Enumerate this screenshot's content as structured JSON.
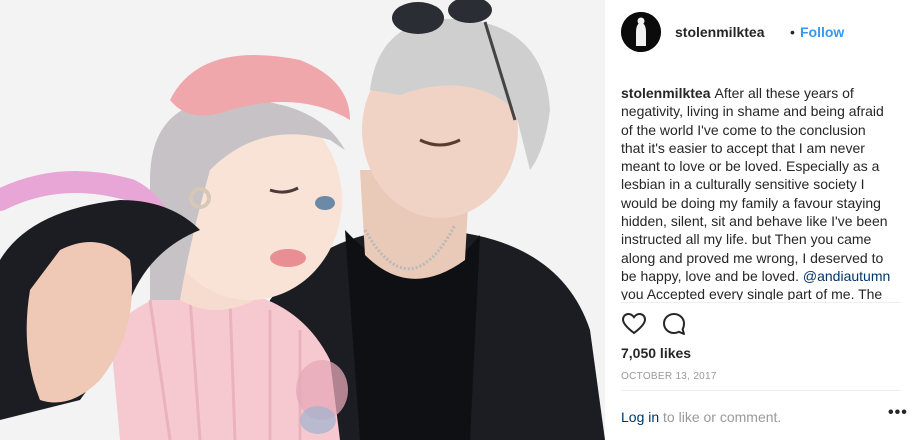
{
  "post": {
    "image_alt": "",
    "header": {
      "username": "stolenmilktea",
      "separator": "•",
      "follow_label": "Follow"
    },
    "caption": {
      "username": "stolenmilktea",
      "text_before_mention": "After all these years of negativity, living in shame and being afraid of the world I've come to the conclusion that it's easier to accept that I am never meant to love or be loved. Especially as a lesbian in a culturally sensitive society I would be doing my family a favour staying hidden, silent, sit and behave like I've been instructed all my life. but Then you came along and proved me wrong, I deserved to be happy, love and be loved.",
      "mention": "@andiautumn",
      "text_after_mention": "you Accepted every single part of me. The"
    },
    "actions": {
      "like_icon": "heart-icon",
      "comment_icon": "comment-icon"
    },
    "likes": "7,050 likes",
    "date": "OCTOBER 13, 2017",
    "comment_prompt": {
      "login_label": "Log in",
      "suffix": " to like or comment."
    },
    "more_label": "•••"
  },
  "colors": {
    "link_blue": "#3897f0",
    "mention_blue": "#003569",
    "muted_gray": "#999999",
    "text": "#262626"
  }
}
